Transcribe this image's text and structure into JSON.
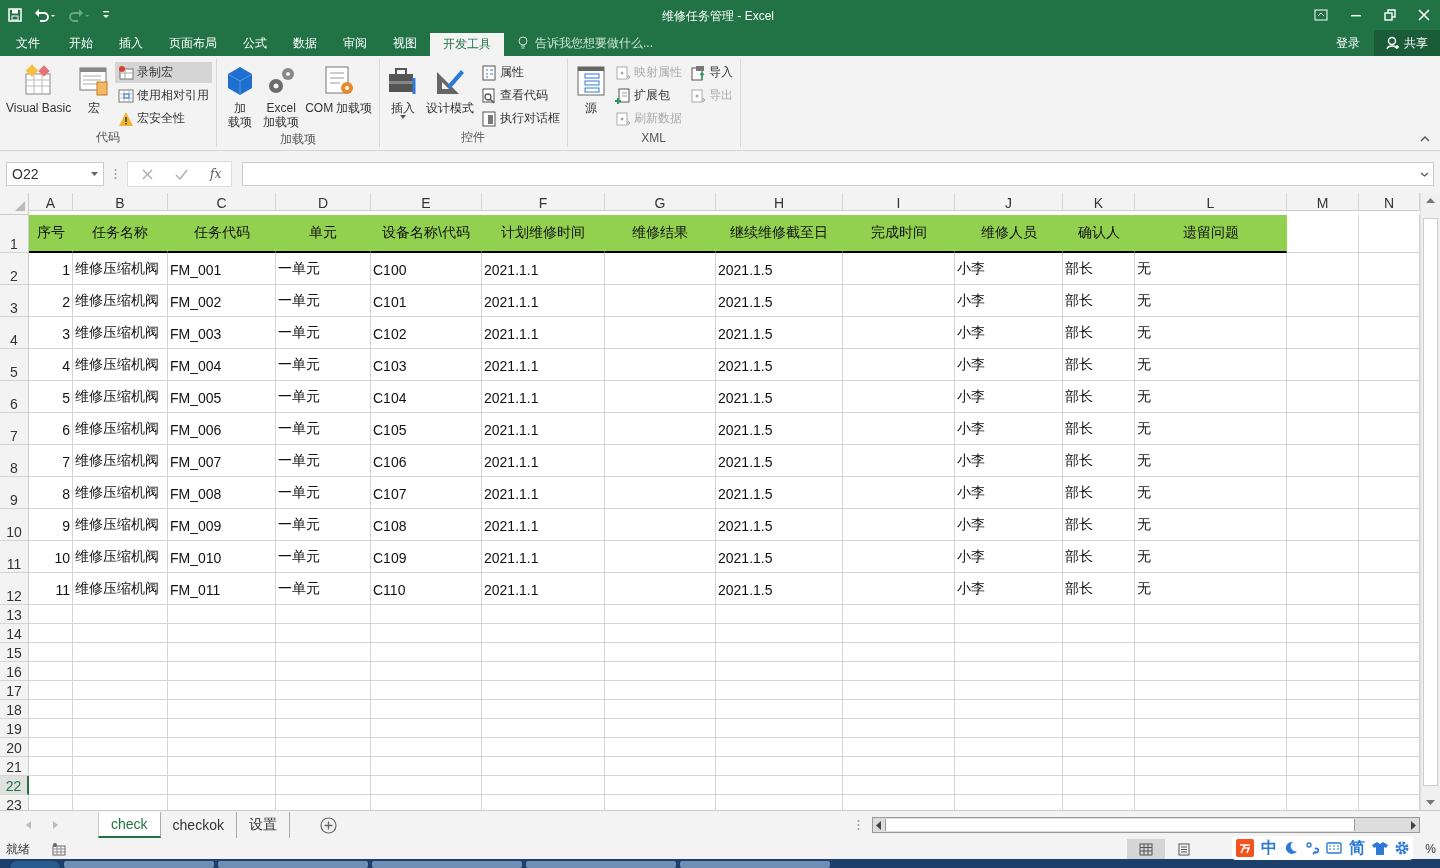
{
  "window": {
    "title": "维修任务管理 - Excel"
  },
  "menu_tabs": [
    {
      "label": "文件",
      "selected": false
    },
    {
      "label": "开始",
      "selected": false
    },
    {
      "label": "插入",
      "selected": false
    },
    {
      "label": "页面布局",
      "selected": false
    },
    {
      "label": "公式",
      "selected": false
    },
    {
      "label": "数据",
      "selected": false
    },
    {
      "label": "审阅",
      "selected": false
    },
    {
      "label": "视图",
      "selected": false
    },
    {
      "label": "开发工具",
      "selected": true
    }
  ],
  "tell_me": {
    "placeholder": "告诉我您想要做什么..."
  },
  "account": {
    "sign_in": "登录",
    "share": "共享"
  },
  "ribbon_groups": [
    {
      "label": "代码",
      "commands": [
        {
          "kind": "large",
          "label_lines": [
            "Visual Basic"
          ],
          "disabled": false,
          "highlighted": false
        },
        {
          "kind": "large",
          "label_lines": [
            "宏"
          ],
          "disabled": false,
          "highlighted": false
        },
        {
          "kind": "small",
          "label": "录制宏",
          "disabled": false,
          "highlighted": true
        },
        {
          "kind": "small",
          "label": "使用相对引用",
          "disabled": false,
          "highlighted": false
        },
        {
          "kind": "small",
          "label": "宏安全性",
          "disabled": false,
          "highlighted": false
        }
      ]
    },
    {
      "label": "加载项",
      "commands": [
        {
          "kind": "large",
          "label_lines": [
            "加",
            "载项"
          ],
          "disabled": false,
          "highlighted": false
        },
        {
          "kind": "large",
          "label_lines": [
            "Excel",
            "加载项"
          ],
          "disabled": false,
          "highlighted": false
        },
        {
          "kind": "large",
          "label_lines": [
            "COM 加载项"
          ],
          "disabled": false,
          "highlighted": false
        }
      ]
    },
    {
      "label": "控件",
      "commands": [
        {
          "kind": "large",
          "label_lines": [
            "插入"
          ],
          "dropdown": true,
          "disabled": false,
          "highlighted": false
        },
        {
          "kind": "large",
          "label_lines": [
            "设计模式"
          ],
          "disabled": false,
          "highlighted": false
        },
        {
          "kind": "small",
          "label": "属性",
          "disabled": false,
          "highlighted": false
        },
        {
          "kind": "small",
          "label": "查看代码",
          "disabled": false,
          "highlighted": false
        },
        {
          "kind": "small",
          "label": "执行对话框",
          "disabled": false,
          "highlighted": false
        }
      ]
    },
    {
      "label": "XML",
      "commands": [
        {
          "kind": "large",
          "label_lines": [
            "源"
          ],
          "disabled": false,
          "highlighted": false
        },
        {
          "kind": "small",
          "label": "映射属性",
          "disabled": true,
          "highlighted": false
        },
        {
          "kind": "small",
          "label": "扩展包",
          "disabled": false,
          "highlighted": false
        },
        {
          "kind": "small",
          "label": "刷新数据",
          "disabled": true,
          "highlighted": false
        },
        {
          "kind": "small",
          "label": "导入",
          "disabled": false,
          "highlighted": false
        },
        {
          "kind": "small",
          "label": "导出",
          "disabled": true,
          "highlighted": false
        }
      ]
    }
  ],
  "formula_bar": {
    "name_box": "O22",
    "function_label": "fx"
  },
  "columns": [
    {
      "letter": "A",
      "selected": false
    },
    {
      "letter": "B",
      "selected": false
    },
    {
      "letter": "C",
      "selected": false
    },
    {
      "letter": "D",
      "selected": false
    },
    {
      "letter": "E",
      "selected": false
    },
    {
      "letter": "F",
      "selected": false
    },
    {
      "letter": "G",
      "selected": false
    },
    {
      "letter": "H",
      "selected": false
    },
    {
      "letter": "I",
      "selected": false
    },
    {
      "letter": "J",
      "selected": false
    },
    {
      "letter": "K",
      "selected": false
    },
    {
      "letter": "L",
      "selected": false
    },
    {
      "letter": "M",
      "selected": false
    },
    {
      "letter": "N",
      "selected": false
    }
  ],
  "header_row": {
    "number": "1",
    "selected": false,
    "cells": [
      "序号",
      "任务名称",
      "任务代码",
      "单元",
      "设备名称\\代码",
      "计划维修时间",
      "维修结果",
      "继续维修截至日",
      "完成时间",
      "维修人员",
      "确认人",
      "遗留问题"
    ]
  },
  "rows": [
    {
      "number": "2",
      "selected": false,
      "cells": [
        "1",
        "维修压缩机阀",
        "FM_001",
        "一单元",
        "C100",
        "2021.1.1",
        null,
        "2021.1.5",
        null,
        "小李",
        "部长",
        "无"
      ]
    },
    {
      "number": "3",
      "selected": false,
      "cells": [
        "2",
        "维修压缩机阀",
        "FM_002",
        "一单元",
        "C101",
        "2021.1.1",
        null,
        "2021.1.5",
        null,
        "小李",
        "部长",
        "无"
      ]
    },
    {
      "number": "4",
      "selected": false,
      "cells": [
        "3",
        "维修压缩机阀",
        "FM_003",
        "一单元",
        "C102",
        "2021.1.1",
        null,
        "2021.1.5",
        null,
        "小李",
        "部长",
        "无"
      ]
    },
    {
      "number": "5",
      "selected": false,
      "cells": [
        "4",
        "维修压缩机阀",
        "FM_004",
        "一单元",
        "C103",
        "2021.1.1",
        null,
        "2021.1.5",
        null,
        "小李",
        "部长",
        "无"
      ]
    },
    {
      "number": "6",
      "selected": false,
      "cells": [
        "5",
        "维修压缩机阀",
        "FM_005",
        "一单元",
        "C104",
        "2021.1.1",
        null,
        "2021.1.5",
        null,
        "小李",
        "部长",
        "无"
      ]
    },
    {
      "number": "7",
      "selected": false,
      "cells": [
        "6",
        "维修压缩机阀",
        "FM_006",
        "一单元",
        "C105",
        "2021.1.1",
        null,
        "2021.1.5",
        null,
        "小李",
        "部长",
        "无"
      ]
    },
    {
      "number": "8",
      "selected": false,
      "cells": [
        "7",
        "维修压缩机阀",
        "FM_007",
        "一单元",
        "C106",
        "2021.1.1",
        null,
        "2021.1.5",
        null,
        "小李",
        "部长",
        "无"
      ]
    },
    {
      "number": "9",
      "selected": false,
      "cells": [
        "8",
        "维修压缩机阀",
        "FM_008",
        "一单元",
        "C107",
        "2021.1.1",
        null,
        "2021.1.5",
        null,
        "小李",
        "部长",
        "无"
      ]
    },
    {
      "number": "10",
      "selected": false,
      "cells": [
        "9",
        "维修压缩机阀",
        "FM_009",
        "一单元",
        "C108",
        "2021.1.1",
        null,
        "2021.1.5",
        null,
        "小李",
        "部长",
        "无"
      ]
    },
    {
      "number": "11",
      "selected": false,
      "cells": [
        "10",
        "维修压缩机阀",
        "FM_010",
        "一单元",
        "C109",
        "2021.1.1",
        null,
        "2021.1.5",
        null,
        "小李",
        "部长",
        "无"
      ]
    },
    {
      "number": "12",
      "selected": false,
      "cells": [
        "11",
        "维修压缩机阀",
        "FM_011",
        "一单元",
        "C110",
        "2021.1.1",
        null,
        "2021.1.5",
        null,
        "小李",
        "部长",
        "无"
      ]
    },
    {
      "number": "13",
      "selected": false
    },
    {
      "number": "14",
      "selected": false
    },
    {
      "number": "15",
      "selected": false
    },
    {
      "number": "16",
      "selected": false
    },
    {
      "number": "17",
      "selected": false
    },
    {
      "number": "18",
      "selected": false
    },
    {
      "number": "19",
      "selected": false
    },
    {
      "number": "20",
      "selected": false
    },
    {
      "number": "21",
      "selected": false
    },
    {
      "number": "22",
      "selected": true
    },
    {
      "number": "23",
      "selected": false
    }
  ],
  "sheet_tabs": [
    {
      "label": "check",
      "selected": true
    },
    {
      "label": "checkok",
      "selected": false
    },
    {
      "label": "设置",
      "selected": false
    }
  ],
  "status_bar": {
    "status": "就绪",
    "view_buttons": [
      {
        "kind": "normal",
        "selected": true
      },
      {
        "kind": "page_layout",
        "selected": false
      }
    ],
    "zoom": "%"
  },
  "ime_toolbar": {
    "mode": "中",
    "script": "简"
  }
}
